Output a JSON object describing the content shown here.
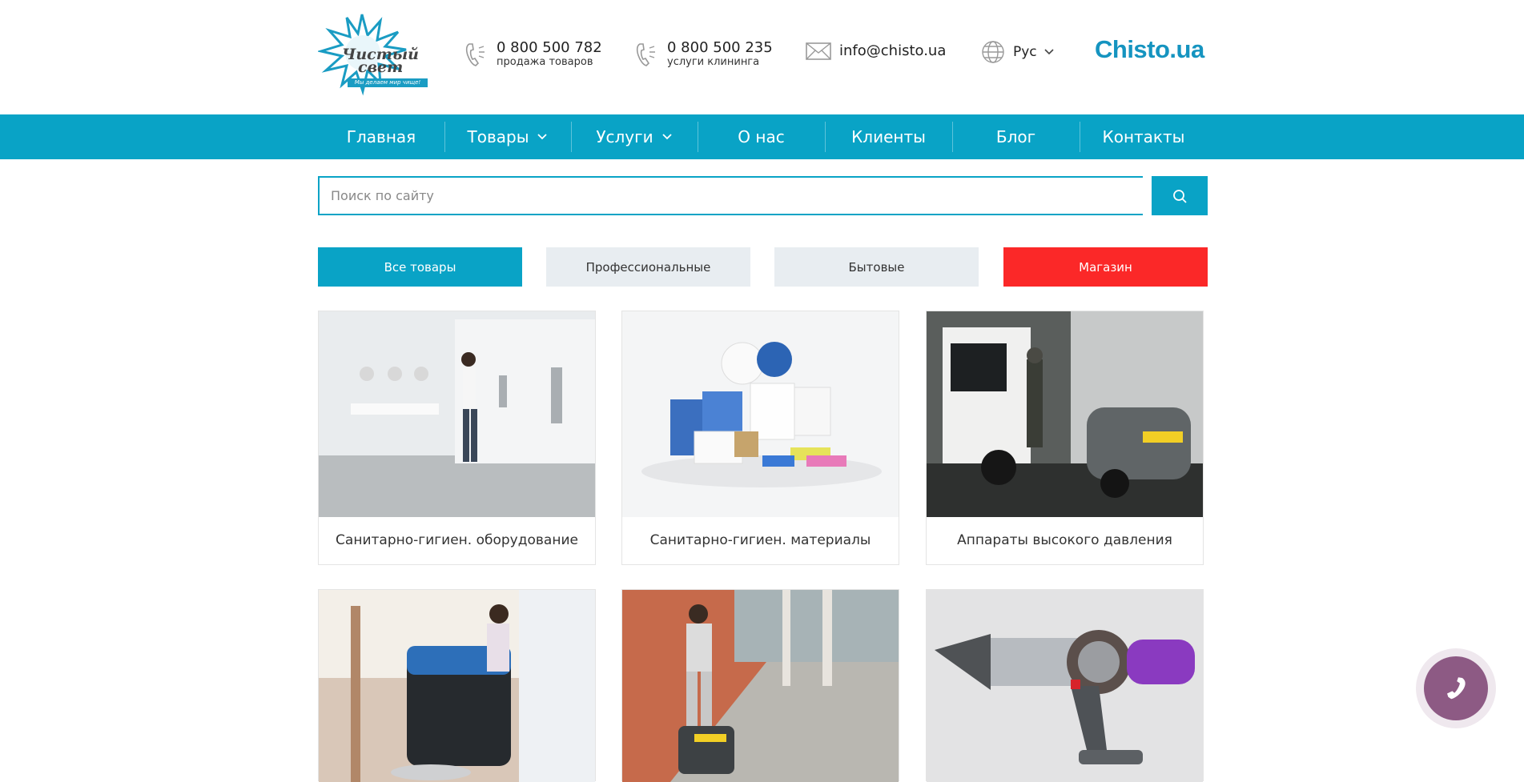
{
  "header": {
    "logo_text_1": "Чистый",
    "logo_text_2": "свет",
    "logo_slogan": "Мы делаем мир чище!",
    "phones": [
      {
        "number": "0 800 500 782",
        "label": "продажа товаров"
      },
      {
        "number": "0 800 500 235",
        "label": "услуги клининга"
      }
    ],
    "email": "info@chisto.ua",
    "language": "Рус",
    "brand": "Chisto.ua"
  },
  "nav": {
    "items": [
      {
        "label": "Главная"
      },
      {
        "label": "Товары"
      },
      {
        "label": "Услуги"
      },
      {
        "label": "О нас"
      },
      {
        "label": "Клиенты"
      },
      {
        "label": "Блог"
      },
      {
        "label": "Контакты"
      }
    ]
  },
  "search": {
    "placeholder": "Поиск по сайту"
  },
  "filters": {
    "items": [
      {
        "label": "Все товары",
        "bg": "#09a3c6",
        "color": "#ffffff"
      },
      {
        "label": "Профессиональные",
        "bg": "#e8edf1",
        "color": "#333333"
      },
      {
        "label": "Бытовые",
        "bg": "#e8edf1",
        "color": "#333333"
      },
      {
        "label": "Магазин",
        "bg": "#fb2828",
        "color": "#ffffff"
      }
    ]
  },
  "categories": [
    {
      "title": "Санитарно-гигиен. оборудование"
    },
    {
      "title": "Санитарно-гигиен. материалы"
    },
    {
      "title": "Аппараты высокого давления"
    },
    {
      "title": ""
    },
    {
      "title": ""
    },
    {
      "title": ""
    }
  ],
  "colors": {
    "accent": "#09a3c6",
    "shop_red": "#fb2828",
    "phone_fab": "#8d5a84"
  }
}
